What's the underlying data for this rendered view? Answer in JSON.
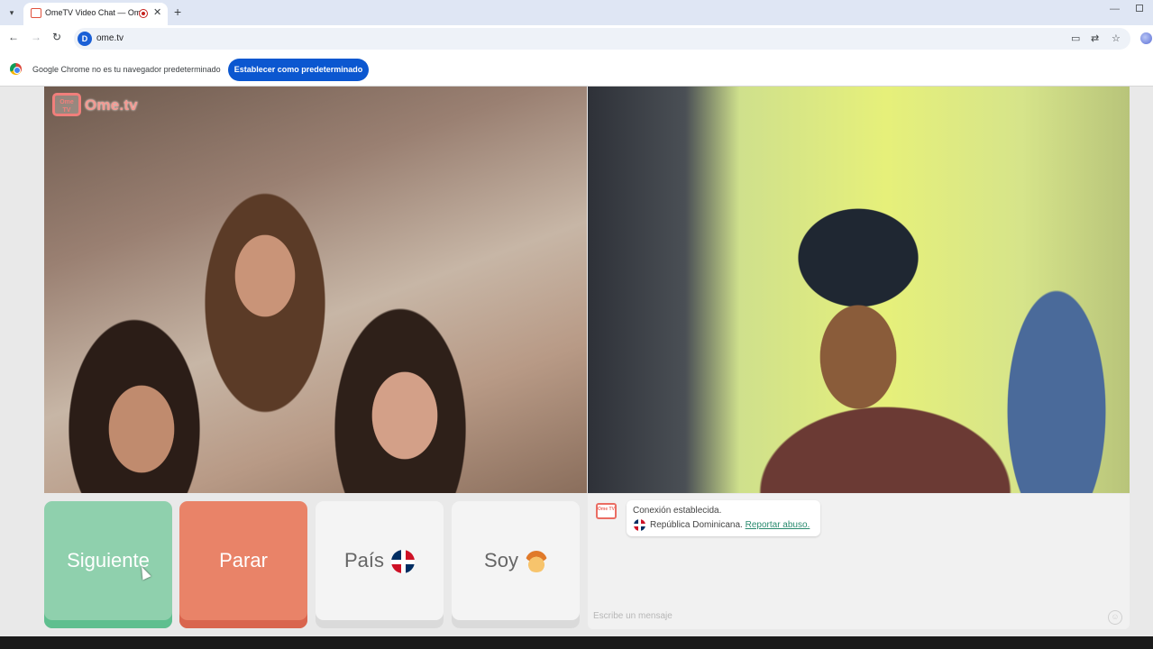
{
  "browser": {
    "tab_title": "OmeTV Video Chat — Ome",
    "tab_close": "✕",
    "new_tab": "+",
    "url": "ome.tv",
    "site_icon_letter": "D",
    "infobar_text": "Google Chrome no es tu navegador predeterminado",
    "infobar_button": "Establecer como predeterminado"
  },
  "brand": {
    "tv_label": "Ome TV",
    "name": "Ome.tv"
  },
  "controls": {
    "next_label": "Siguiente",
    "stop_label": "Parar",
    "country_label": "País",
    "gender_label": "Soy"
  },
  "chat": {
    "icon_label": "Ome TV",
    "status_message": "Conexión establecida.",
    "country_name": "República Dominicana.",
    "report_link": "Reportar abuso.",
    "input_placeholder": "Escribe un mensaje"
  },
  "colors": {
    "next_button": "#8fd0ad",
    "stop_button": "#e98368",
    "brand_accent": "#f07f7b",
    "report_link": "#2a8b6f"
  },
  "icons": {
    "country_flag": "dominican-republic-flag-icon",
    "gender": "boy-face-icon",
    "emoji": "smiley-icon"
  }
}
